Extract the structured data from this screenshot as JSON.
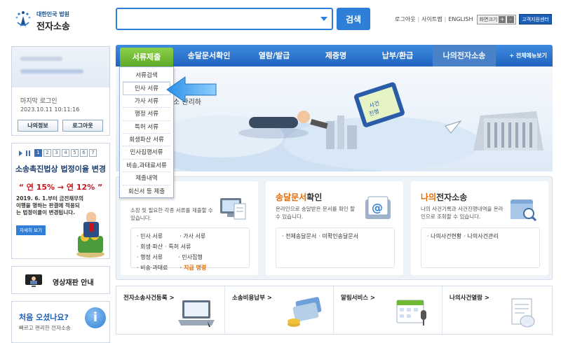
{
  "header": {
    "logo_top": "대한민국 법원",
    "logo_main": "전자소송",
    "search_value": "",
    "search_button": "검색",
    "util_links": [
      "로그아웃",
      "사이트맵",
      "ENGLISH"
    ],
    "zoom_label": "화면크기",
    "zoom_plus": "+",
    "zoom_minus": "-",
    "help_button": "고객지원센터"
  },
  "nav": {
    "items": [
      "서류제출",
      "송달문서확인",
      "열람/발급",
      "제증명",
      "납부/환급",
      "나의전자소송"
    ],
    "all_menu": "+ 전체메뉴보기"
  },
  "dropdown": {
    "items": [
      "서류검색",
      "민사 서류",
      "가사 서류",
      "행정 서류",
      "특허 서류",
      "회생파산 서류",
      "민사집행서류",
      "비송,과태료서류",
      "제출내역",
      "회신서 등 제출"
    ]
  },
  "login": {
    "last_login_label": "마지막 로그인",
    "last_login_time": "2023.10.11 10:11:16",
    "myinfo_button": "나의정보",
    "logout_button": "로그아웃"
  },
  "promo": {
    "pages": [
      "1",
      "2",
      "3",
      "4",
      "5",
      "6",
      "7"
    ],
    "title": "소송촉진법상 법정이율 변경",
    "rate": "“ 연 15% → 연 12% ”",
    "text": "2019. 6. 1.부터 금전채무의 이행을 명하는 판결에 적용되는 법정이율이 변경됩니다.",
    "button": "자세히 보기"
  },
  "video": {
    "label": "영상재판 안내"
  },
  "first_visit": {
    "title": "처음 오셨나요?",
    "subtitle": "빠르고 편리한 전자소송",
    "icon": "i"
  },
  "hero": {
    "text": "소 관리하"
  },
  "cards": [
    {
      "title_pre": "",
      "title_hl": "",
      "title_post": "",
      "desc": "소장 및 필요한 각종 서류를 제출할 수 있습니다.",
      "links": [
        "· 민사 서류",
        "· 가사 서류",
        "· 회생·파산",
        "· 특허 서류",
        "· 행정 서류",
        "· 민사집행",
        "· 비송·과태료",
        "· 지급 명령"
      ]
    },
    {
      "title_pre": "송달문서",
      "title_hl": "",
      "title_post": "확인",
      "desc": "온라인으로 송달받은 문서를 확인 할 수 있습니다.",
      "links": [
        "· 전체송달문서",
        "· 미확인송달문서"
      ]
    },
    {
      "title_pre": "나의",
      "title_hl": "",
      "title_post": "전자소송",
      "desc": "나의 사건기록과 사건진행내역을 온라인으로 조회할 수 있습니다.",
      "links": [
        "· 나의사건현황",
        "· 나의사건관리"
      ]
    }
  ],
  "quick": [
    "전자소송사건등록 >",
    "소송비용납부 >",
    "알림서비스 >",
    "나의사건열람 >"
  ],
  "colors": {
    "primary": "#2f7fd8",
    "active_tab": "#6fb834",
    "highlight": "#e46a00",
    "nav_dark": "#1f63bf"
  }
}
